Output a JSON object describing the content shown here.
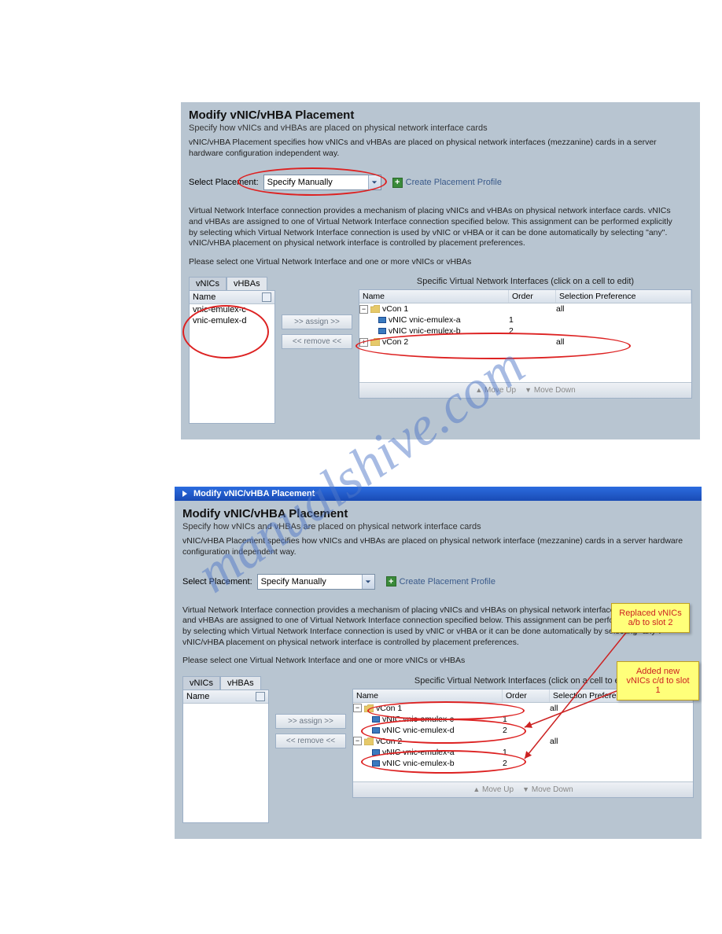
{
  "watermark": "manualshive.com",
  "dialog1": {
    "title": "Modify vNIC/vHBA Placement",
    "subtitle": "Specify how vNICs and vHBAs are placed on physical network interface cards",
    "desc_top": "vNIC/vHBA Placement specifies how vNICs and vHBAs are placed on physical network interfaces (mezzanine) cards in a server hardware configuration independent way.",
    "select_label": "Select Placement:",
    "select_value": "Specify Manually",
    "create_link": "Create Placement Profile",
    "desc_mid": "Virtual Network Interface connection provides a mechanism of placing vNICs and vHBAs on physical network interface cards. vNICs and vHBAs are assigned to one of Virtual Network Interface connection specified below. This assignment can be performed explicitly by selecting which Virtual Network Interface connection is used by vNIC or vHBA or it can be done automatically by selecting \"any\". vNIC/vHBA placement on physical network interface is controlled by placement preferences.",
    "desc_select": "Please select one Virtual Network Interface and one or more vNICs or vHBAs",
    "tab_vnics": "vNICs",
    "tab_vhbas": "vHBAs",
    "list_header": "Name",
    "list_items": [
      "vnic-emulex-c",
      "vnic-emulex-d"
    ],
    "btn_assign": ">> assign >>",
    "btn_remove": "<< remove <<",
    "grid_caption": "Specific Virtual Network Interfaces (click on a cell to edit)",
    "grid_headers": {
      "name": "Name",
      "order": "Order",
      "sel": "Selection Preference"
    },
    "tree": [
      {
        "type": "group",
        "name": "vCon 1",
        "sel": "all",
        "expanded": true
      },
      {
        "type": "child",
        "name": "vNIC vnic-emulex-a",
        "order": "1"
      },
      {
        "type": "child",
        "name": "vNIC vnic-emulex-b",
        "order": "2"
      },
      {
        "type": "group",
        "name": "vCon 2",
        "sel": "all",
        "expanded": false
      }
    ],
    "footer_up": "Move Up",
    "footer_down": "Move Down"
  },
  "dialog2": {
    "titlebar": "Modify vNIC/vHBA Placement",
    "title": "Modify vNIC/vHBA Placement",
    "subtitle": "Specify how vNICs and vHBAs are placed on physical network interface cards",
    "desc_top": "vNIC/vHBA Placement specifies how vNICs and vHBAs are placed on physical network interface (mezzanine) cards in a server hardware configuration independent way.",
    "select_label": "Select Placement:",
    "select_value": "Specify Manually",
    "create_link": "Create Placement Profile",
    "desc_mid": "Virtual Network Interface connection provides a mechanism of placing vNICs and vHBAs on physical network interface cards. vNICs and vHBAs are assigned to one of Virtual Network Interface connection specified below. This assignment can be performed explicitly by selecting which Virtual Network Interface connection is used by vNIC or vHBA or it can be done automatically by selecting \"any\". vNIC/vHBA placement on physical network interface is controlled by placement preferences.",
    "desc_select": "Please select one Virtual Network Interface and one or more vNICs or vHBAs",
    "tab_vnics": "vNICs",
    "tab_vhbas": "vHBAs",
    "list_header": "Name",
    "list_items": [],
    "btn_assign": ">> assign >>",
    "btn_remove": "<< remove <<",
    "grid_caption": "Specific Virtual Network Interfaces (click on a cell to edit)",
    "grid_headers": {
      "name": "Name",
      "order": "Order",
      "sel": "Selection Preference"
    },
    "tree": [
      {
        "type": "group",
        "name": "vCon 1",
        "sel": "all",
        "expanded": true
      },
      {
        "type": "child",
        "name": "vNIC vnic-emulex-c",
        "order": "1"
      },
      {
        "type": "child",
        "name": "vNIC vnic-emulex-d",
        "order": "2"
      },
      {
        "type": "group",
        "name": "vCon 2",
        "sel": "all",
        "expanded": true
      },
      {
        "type": "child",
        "name": "vNIC vnic-emulex-a",
        "order": "1"
      },
      {
        "type": "child",
        "name": "vNIC vnic-emulex-b",
        "order": "2"
      }
    ],
    "footer_up": "Move Up",
    "footer_down": "Move Down",
    "callout1": "Replaced vNICs a/b to slot 2",
    "callout2": "Added new vNICs c/d to slot 1"
  }
}
